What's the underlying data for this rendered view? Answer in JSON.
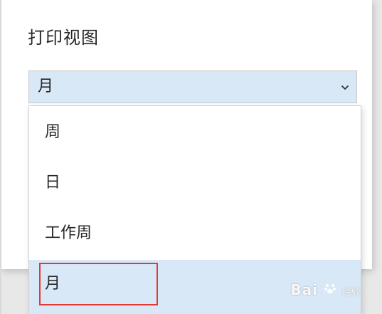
{
  "dialog": {
    "title": "打印视图"
  },
  "view_select": {
    "selected_value": "月",
    "options": [
      "周",
      "日",
      "工作周",
      "月"
    ],
    "highlighted_option": "月",
    "accent_color": "#d8e8f7"
  },
  "annotation": {
    "highlight_color": "#e53935"
  },
  "watermark": {
    "text": "Bai",
    "suffix": "经验"
  },
  "icons": {
    "dropdown": "chevron-down-icon"
  }
}
